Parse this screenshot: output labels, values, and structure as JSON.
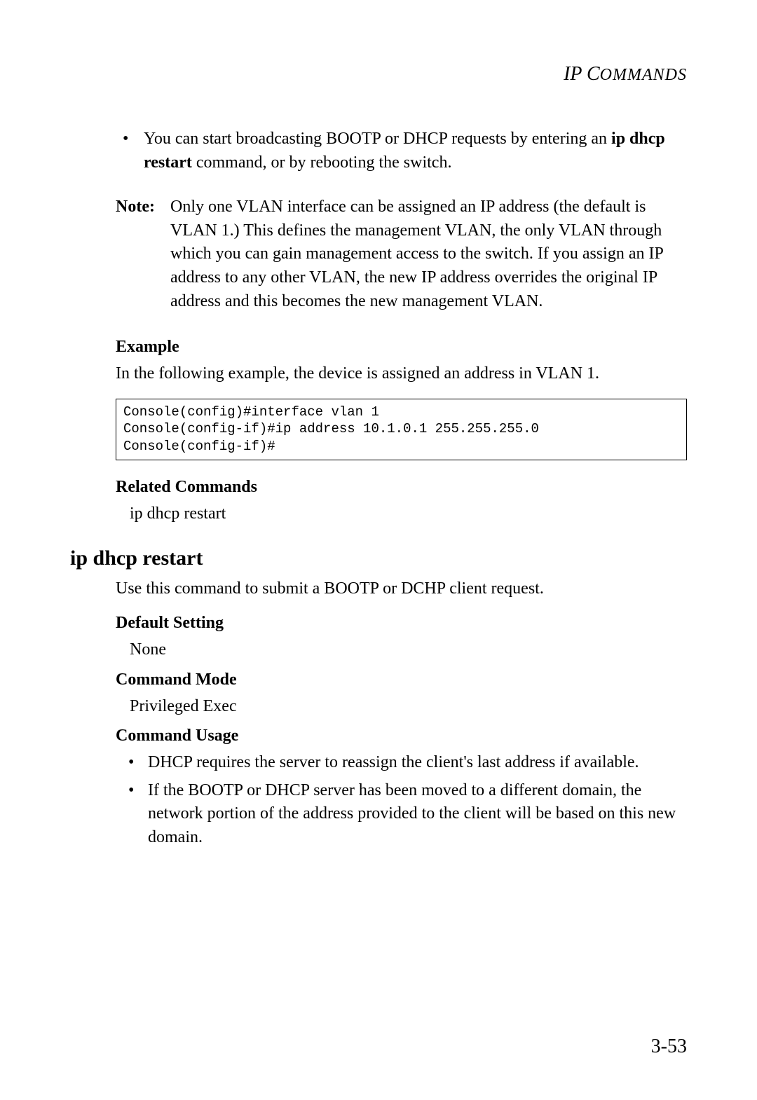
{
  "header": {
    "prefix": "IP C",
    "suffix": "OMMANDS"
  },
  "bullet1": {
    "text_part1": "You can start broadcasting BOOTP or DHCP requests by entering an ",
    "bold": "ip dhcp restart",
    "text_part2": " command, or by rebooting the switch."
  },
  "note": {
    "label": "Note:",
    "text": "Only one VLAN interface can be assigned an IP address (the default is VLAN 1.) This defines the management VLAN, the only VLAN through which you can gain management access to the switch. If you assign an IP address to any other VLAN, the new IP address overrides the original IP address and this becomes the new management VLAN."
  },
  "example": {
    "heading": "Example",
    "intro": "In the following example, the device is assigned an address in VLAN 1.",
    "code": "Console(config)#interface vlan 1\nConsole(config-if)#ip address 10.1.0.1 255.255.255.0\nConsole(config-if)#"
  },
  "related": {
    "heading": "Related Commands",
    "text": "ip dhcp restart"
  },
  "command": {
    "title": "ip dhcp restart",
    "description": "Use this command to submit a BOOTP or DCHP client request."
  },
  "default_setting": {
    "heading": "Default Setting",
    "value": "None"
  },
  "command_mode": {
    "heading": "Command Mode",
    "value": "Privileged Exec"
  },
  "command_usage": {
    "heading": "Command Usage",
    "items": [
      "DHCP requires the server to reassign the client's last address if available.",
      "If the BOOTP or DHCP server has been moved to a different domain, the network portion of the address provided to the client will be based on this new domain."
    ]
  },
  "page_number": "3-53"
}
